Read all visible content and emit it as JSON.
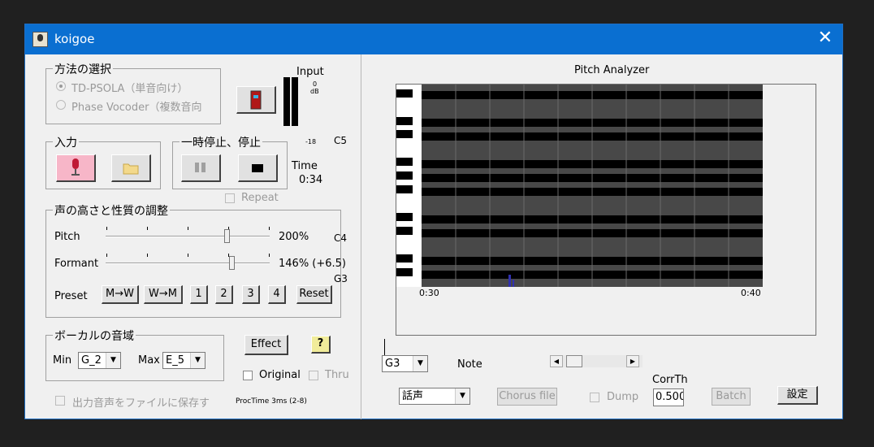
{
  "window": {
    "title": "koigoe"
  },
  "method": {
    "title": "方法の選択",
    "options": [
      "TD-PSOLA（単音向け）",
      "Phase Vocoder（複数音向"
    ],
    "selected": 0
  },
  "input": {
    "title": "入力"
  },
  "pause": {
    "title": "一時停止、停止"
  },
  "meter": {
    "label": "Input",
    "top": "0",
    "unit": "dB",
    "min": "-18"
  },
  "time": {
    "label": "Time",
    "value": "0:34"
  },
  "repeat_label": "Repeat",
  "adjust": {
    "title": "声の高さと性質の調整",
    "pitch_label": "Pitch",
    "pitch_value": "200%",
    "pitch_level": 0.75,
    "formant_label": "Formant",
    "formant_value": "146% (+6.5)",
    "formant_level": 0.78,
    "preset_label": "Preset",
    "presets": [
      "M→W",
      "W→M",
      "1",
      "2",
      "3",
      "4",
      "Reset"
    ]
  },
  "notes": {
    "c5": "C5",
    "c4": "C4",
    "g3": "G3"
  },
  "range": {
    "title": "ボーカルの音域",
    "min_label": "Min",
    "min_value": "G_2",
    "max_label": "Max",
    "max_value": "E_5"
  },
  "effect_label": "Effect",
  "help_label": "?",
  "original_label": "Original",
  "thru_label": "Thru",
  "save_label": "出力音声をファイルに保存す",
  "proctime": "ProcTime 3ms (2-8)",
  "analyzer": {
    "title": "Pitch Analyzer",
    "t_start": "0:30",
    "t_end": "0:40",
    "note_select": "G3",
    "note_label": "Note",
    "voice_select": "話声",
    "chorus_label": "Chorus file",
    "dump_label": "Dump",
    "corr_label": "CorrTh",
    "corr_value": "0.500",
    "batch_label": "Batch",
    "settings_label": "設定"
  },
  "colors": {
    "titlebar": "#0a6fd1",
    "record_active": "#f7b6c8"
  }
}
